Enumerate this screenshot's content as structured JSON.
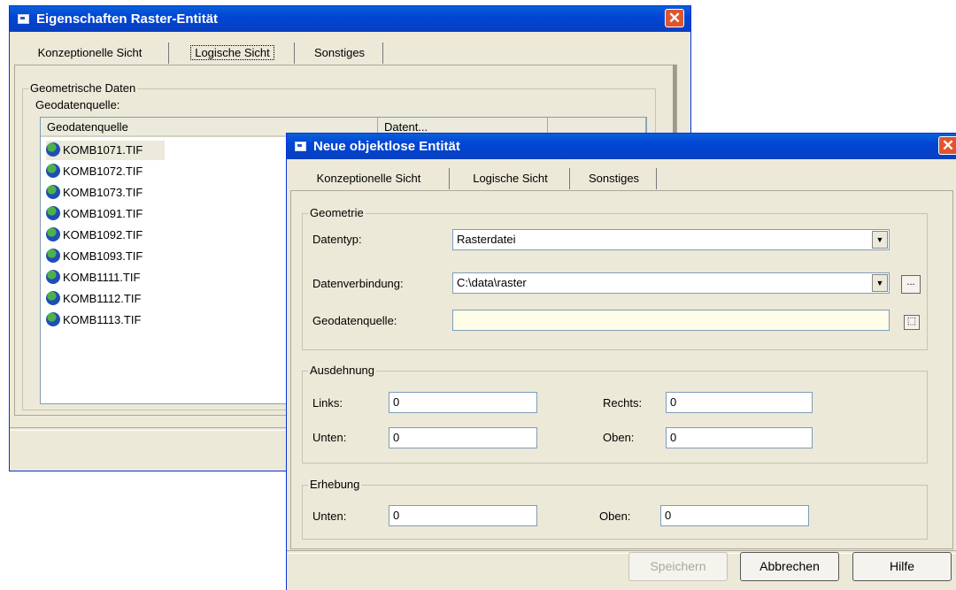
{
  "back_window": {
    "title": "Eigenschaften Raster-Entität",
    "tabs": [
      "Konzeptionelle Sicht",
      "Logische Sicht",
      "Sonstiges"
    ],
    "group_label": "Geometrische Daten",
    "source_label": "Geodatenquelle:",
    "columns": [
      "Geodatenquelle",
      "Datent..."
    ],
    "items": [
      "KOMB1071.TIF",
      "KOMB1072.TIF",
      "KOMB1073.TIF",
      "KOMB1091.TIF",
      "KOMB1092.TIF",
      "KOMB1093.TIF",
      "KOMB1111.TIF",
      "KOMB1112.TIF",
      "KOMB1113.TIF"
    ]
  },
  "front_window": {
    "title": "Neue objektlose Entität",
    "tabs": [
      "Konzeptionelle Sicht",
      "Logische Sicht",
      "Sonstiges"
    ],
    "geometrie": {
      "legend": "Geometrie",
      "datentyp_label": "Datentyp:",
      "datentyp_value": "Rasterdatei",
      "datenverbindung_label": "Datenverbindung:",
      "datenverbindung_value": "C:\\data\\raster",
      "browse_label": "...",
      "geodatenquelle_label": "Geodatenquelle:",
      "geodatenquelle_value": ""
    },
    "ausdehnung": {
      "legend": "Ausdehnung",
      "links_label": "Links:",
      "links_value": "0",
      "rechts_label": "Rechts:",
      "rechts_value": "0",
      "unten_label": "Unten:",
      "unten_value": "0",
      "oben_label": "Oben:",
      "oben_value": "0"
    },
    "erhebung": {
      "legend": "Erhebung",
      "unten_label": "Unten:",
      "unten_value": "0",
      "oben_label": "Oben:",
      "oben_value": "0"
    },
    "buttons": {
      "save": "Speichern",
      "cancel": "Abbrechen",
      "help": "Hilfe"
    }
  },
  "colors": {
    "titlebar": "#0046d5",
    "window_bg": "#ece9d8",
    "close": "#e0542f",
    "highlight_field": "#fffde8"
  }
}
